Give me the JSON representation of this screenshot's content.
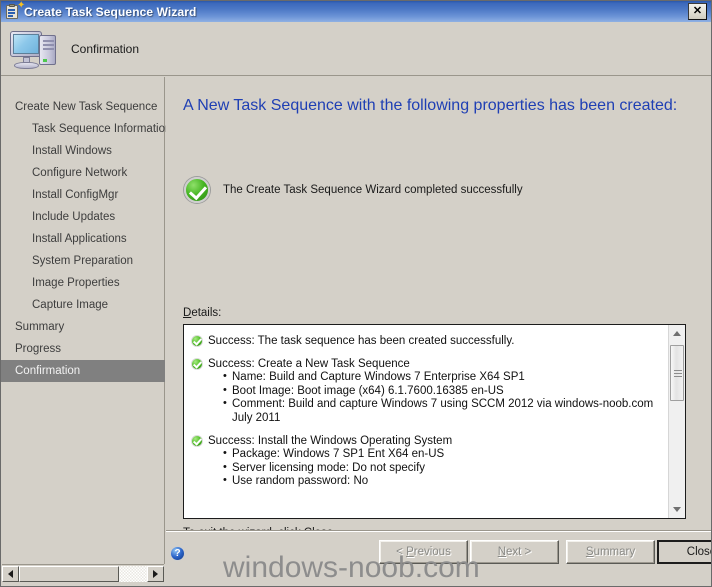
{
  "window": {
    "title": "Create Task Sequence Wizard",
    "icon": "task-sequence-clipboard-icon",
    "close_label": "✕"
  },
  "header": {
    "icon": "computer-monitor-icon",
    "step_title": "Confirmation"
  },
  "sidebar": {
    "items": [
      {
        "label": "Create New Task Sequence",
        "level": 0,
        "selected": false
      },
      {
        "label": "Task Sequence Information",
        "level": 1,
        "selected": false
      },
      {
        "label": "Install Windows",
        "level": 1,
        "selected": false
      },
      {
        "label": "Configure Network",
        "level": 1,
        "selected": false
      },
      {
        "label": "Install ConfigMgr",
        "level": 1,
        "selected": false
      },
      {
        "label": "Include Updates",
        "level": 1,
        "selected": false
      },
      {
        "label": "Install Applications",
        "level": 1,
        "selected": false
      },
      {
        "label": "System Preparation",
        "level": 1,
        "selected": false
      },
      {
        "label": "Image Properties",
        "level": 1,
        "selected": false
      },
      {
        "label": "Capture Image",
        "level": 1,
        "selected": false
      },
      {
        "label": "Summary",
        "level": 0,
        "selected": false
      },
      {
        "label": "Progress",
        "level": 0,
        "selected": false
      },
      {
        "label": "Confirmation",
        "level": 0,
        "selected": true
      }
    ]
  },
  "main": {
    "page_title": "A New Task Sequence with the following properties has been created:",
    "success_icon": "green-check-circle-icon",
    "success_message": "The Create Task Sequence Wizard completed successfully",
    "details_label_accesskey": "D",
    "details_label_rest": "etails:",
    "details": [
      {
        "icon": "green-check-circle-icon",
        "heading": "Success: The task sequence has been created successfully.",
        "bullets": []
      },
      {
        "icon": "green-check-circle-icon",
        "heading": "Success: Create a New Task Sequence",
        "bullets": [
          "Name: Build and Capture Windows 7 Enterprise X64 SP1",
          "Boot Image: Boot image (x64) 6.1.7600.16385 en-US",
          "Comment: Build and capture Windows 7 using SCCM 2012 via windows-noob.com July 2011"
        ]
      },
      {
        "icon": "green-check-circle-icon",
        "heading": "Success: Install the Windows Operating System",
        "bullets": [
          "Package: Windows 7 SP1 Ent X64 en-US",
          "Server licensing mode: Do not specify",
          "Use random password: No"
        ]
      }
    ],
    "exit_note": "To exit the wizard, click Close."
  },
  "footer": {
    "help_icon": "help-question-icon",
    "help_glyph": "?",
    "buttons": [
      {
        "name": "previous",
        "label_prefix": "< ",
        "accesskey": "P",
        "label_rest": "revious",
        "disabled": true
      },
      {
        "name": "next",
        "label_prefix": "",
        "accesskey": "N",
        "label_rest": "ext >",
        "disabled": true
      },
      {
        "name": "summary",
        "label_prefix": "",
        "accesskey": "S",
        "label_rest": "ummary",
        "disabled": true
      },
      {
        "name": "close",
        "label_prefix": "",
        "accesskey": "",
        "label_rest": "Close",
        "disabled": false
      }
    ]
  },
  "scrollbars": {
    "horizontal_left_arrow": "◀",
    "horizontal_right_arrow": "▶",
    "vertical_up_arrow": "▲",
    "vertical_down_arrow": "▼"
  },
  "watermark": {
    "text": "windows-noob.com"
  },
  "colors": {
    "titlebar_blue": "#3b68bb",
    "dialog_face": "#d4d0c8",
    "page_title_blue": "#1f3fb4",
    "selection_grey": "#808080",
    "success_green": "#45b522"
  }
}
